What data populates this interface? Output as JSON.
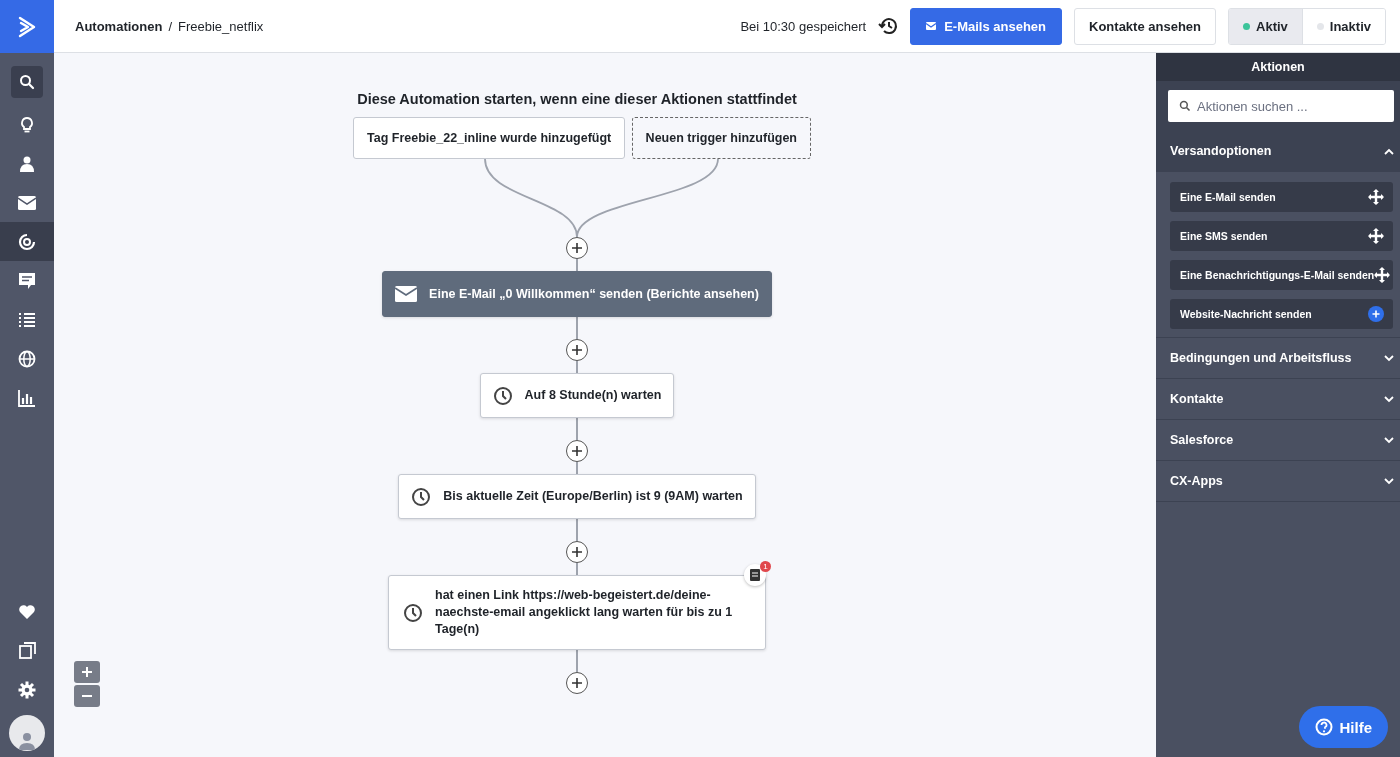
{
  "topbar": {
    "breadcrumb": [
      {
        "label": "Automationen",
        "current": false
      },
      {
        "label": "Freebie_netflix",
        "current": true
      }
    ],
    "separator": "/",
    "saved": "Bei 10:30 gespeichert",
    "emails_button": "E-Mails ansehen",
    "contacts_button": "Kontakte ansehen",
    "status_options": [
      {
        "label": "Aktiv",
        "selected": true,
        "color": "#3cc49a"
      },
      {
        "label": "Inaktiv",
        "selected": false,
        "color": "#e4e6ea"
      }
    ]
  },
  "nav_items": [
    {
      "selected": false
    },
    {
      "selected": false
    },
    {
      "selected": false
    },
    {
      "selected": true
    },
    {
      "selected": false
    },
    {
      "selected": false
    },
    {
      "selected": false
    },
    {
      "selected": false
    }
  ],
  "flow": {
    "title": "Diese Automation starten, wenn eine dieser Aktionen stattfindet",
    "triggers": [
      {
        "kind": "trigger",
        "label": "Tag Freebie_22_inline wurde hinzugefügt"
      },
      {
        "kind": "add",
        "label": "Neuen trigger hinzufügen"
      }
    ],
    "steps": [
      {
        "kind": "email",
        "text": "Eine E-Mail „0 Willkommen“ senden (Berichte ansehen)"
      },
      {
        "kind": "wait",
        "text": "Auf 8 Stunde(n) warten"
      },
      {
        "kind": "wait",
        "text": "Bis aktuelle Zeit (Europe/Berlin) ist 9 (9AM) warten"
      },
      {
        "kind": "goal",
        "text": "hat einen Link https://web-begeistert.de/deine-naechste-email angeklickt lang warten für bis zu 1 Tage(n)",
        "badge": "1"
      }
    ]
  },
  "panel": {
    "title": "Aktionen",
    "search": {
      "placeholder": "Aktionen suchen ..."
    },
    "sections": [
      {
        "label": "Versandoptionen",
        "expanded": true,
        "items": [
          {
            "label": "Eine E-Mail senden",
            "kind": "drag"
          },
          {
            "label": "Eine SMS senden",
            "kind": "drag"
          },
          {
            "label": "Eine Benachrichtigungs-E-Mail senden",
            "kind": "drag"
          },
          {
            "label": "Website-Nachricht senden",
            "kind": "add"
          }
        ]
      },
      {
        "label": "Bedingungen und Arbeitsfluss",
        "expanded": false
      },
      {
        "label": "Kontakte",
        "expanded": false
      },
      {
        "label": "Salesforce",
        "expanded": false
      },
      {
        "label": "CX-Apps",
        "expanded": false
      }
    ]
  },
  "help_button": "Hilfe"
}
